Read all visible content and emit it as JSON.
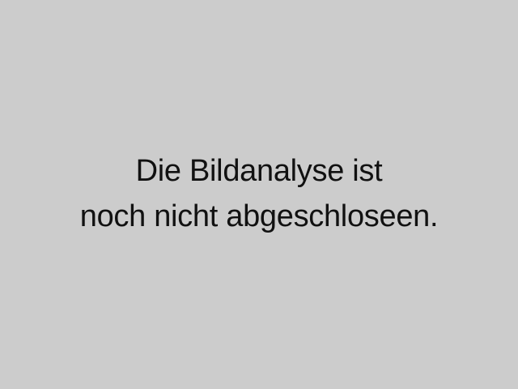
{
  "placeholder": {
    "background_color": "#cccccc",
    "text_color": "#111111",
    "lines": [
      "Die Bildanalyse ist",
      "noch nicht abgeschloseen."
    ]
  }
}
